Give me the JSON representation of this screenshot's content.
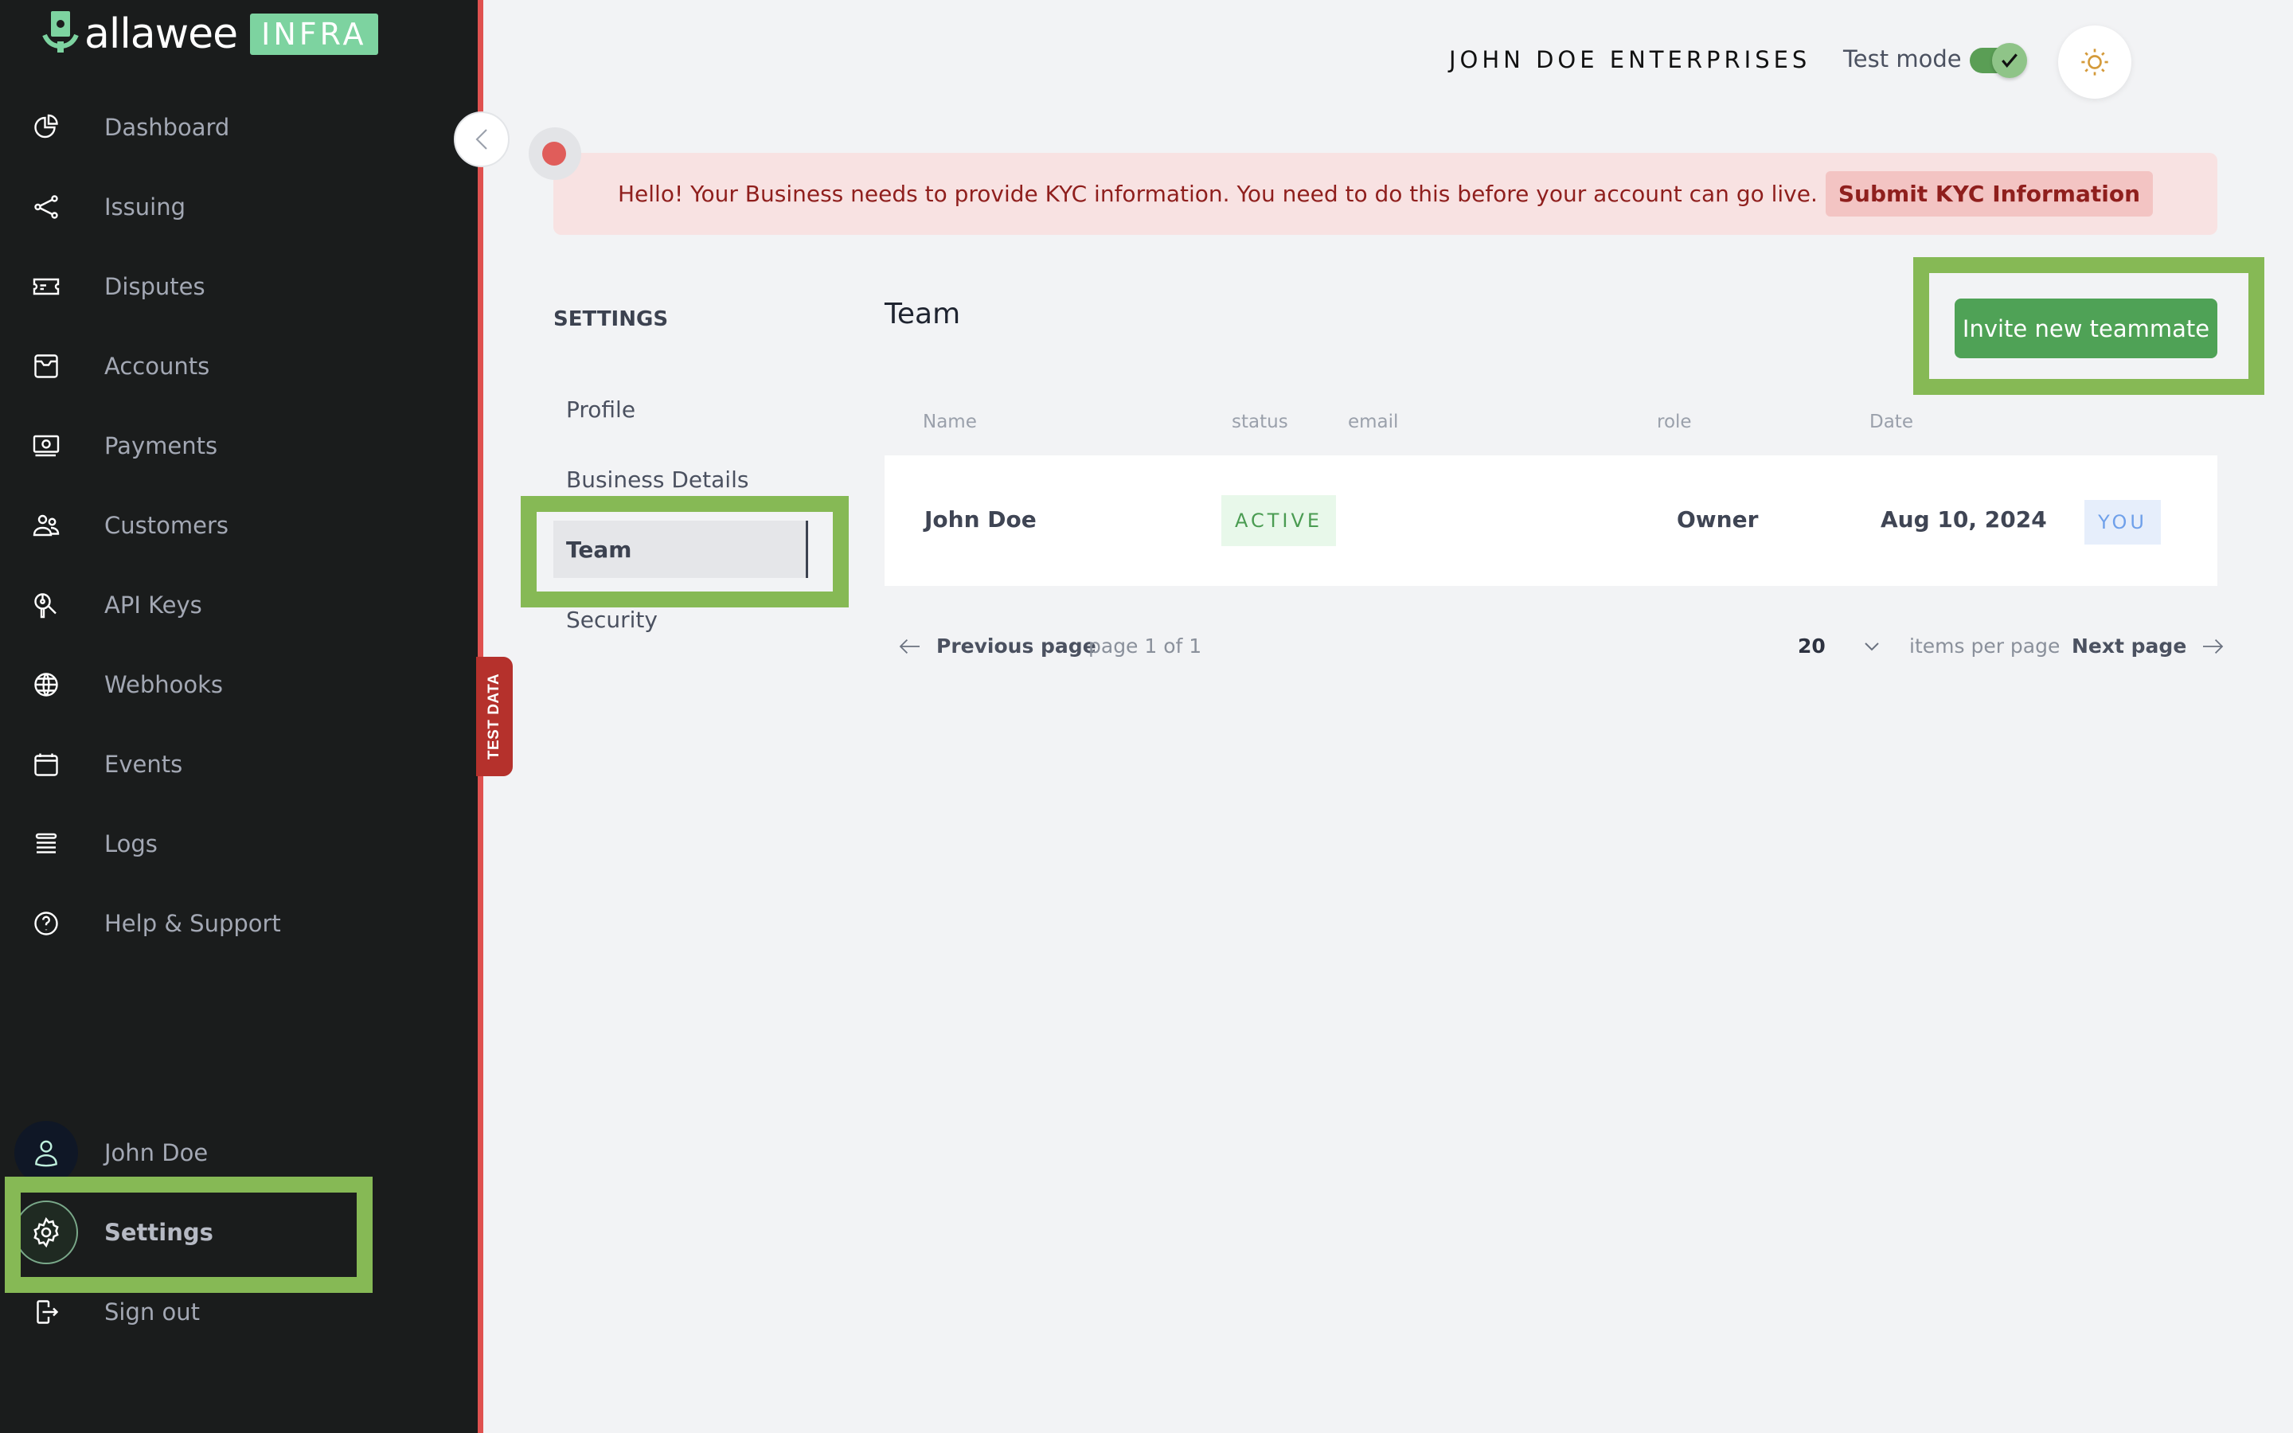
{
  "brand": {
    "name": "allawee",
    "badge": "INFRA",
    "accent": "#7dd3a0"
  },
  "sidebar": {
    "items": [
      {
        "label": "Dashboard",
        "icon": "pie-chart-icon"
      },
      {
        "label": "Issuing",
        "icon": "share-icon"
      },
      {
        "label": "Disputes",
        "icon": "ticket-icon"
      },
      {
        "label": "Accounts",
        "icon": "inbox-icon"
      },
      {
        "label": "Payments",
        "icon": "cash-icon"
      },
      {
        "label": "Customers",
        "icon": "users-icon"
      },
      {
        "label": "API Keys",
        "icon": "key-search-icon"
      },
      {
        "label": "Webhooks",
        "icon": "globe-icon"
      },
      {
        "label": "Events",
        "icon": "calendar-icon"
      },
      {
        "label": "Logs",
        "icon": "list-icon"
      },
      {
        "label": "Help & Support",
        "icon": "help-icon"
      }
    ],
    "user": {
      "label": "John Doe",
      "icon": "user-icon"
    },
    "settings": {
      "label": "Settings",
      "icon": "gear-icon"
    },
    "signout": {
      "label": "Sign out",
      "icon": "sign-out-icon"
    },
    "test_data_tab": "TEST DATA"
  },
  "header": {
    "company": "JOHN DOE ENTERPRISES",
    "test_mode_label": "Test mode",
    "test_mode_on": true
  },
  "banner": {
    "message": "Hello! Your Business needs to provide KYC information. You need to do this before your account can go live.",
    "action": "Submit KYC Information"
  },
  "settings_nav": {
    "title": "SETTINGS",
    "items": [
      "Profile",
      "Business Details",
      "Team",
      "Security"
    ],
    "active": "Team"
  },
  "team": {
    "title": "Team",
    "invite_button": "Invite new teammate",
    "columns": [
      "Name",
      "status",
      "email",
      "role",
      "Date"
    ],
    "rows": [
      {
        "name": "John Doe",
        "status": "ACTIVE",
        "email": "",
        "role": "Owner",
        "date": "Aug 10, 2024",
        "tag": "YOU"
      }
    ]
  },
  "pagination": {
    "previous": "Previous page",
    "page_info": "page 1 of 1",
    "per_page": "20",
    "per_page_label": "items per page",
    "next": "Next page"
  }
}
